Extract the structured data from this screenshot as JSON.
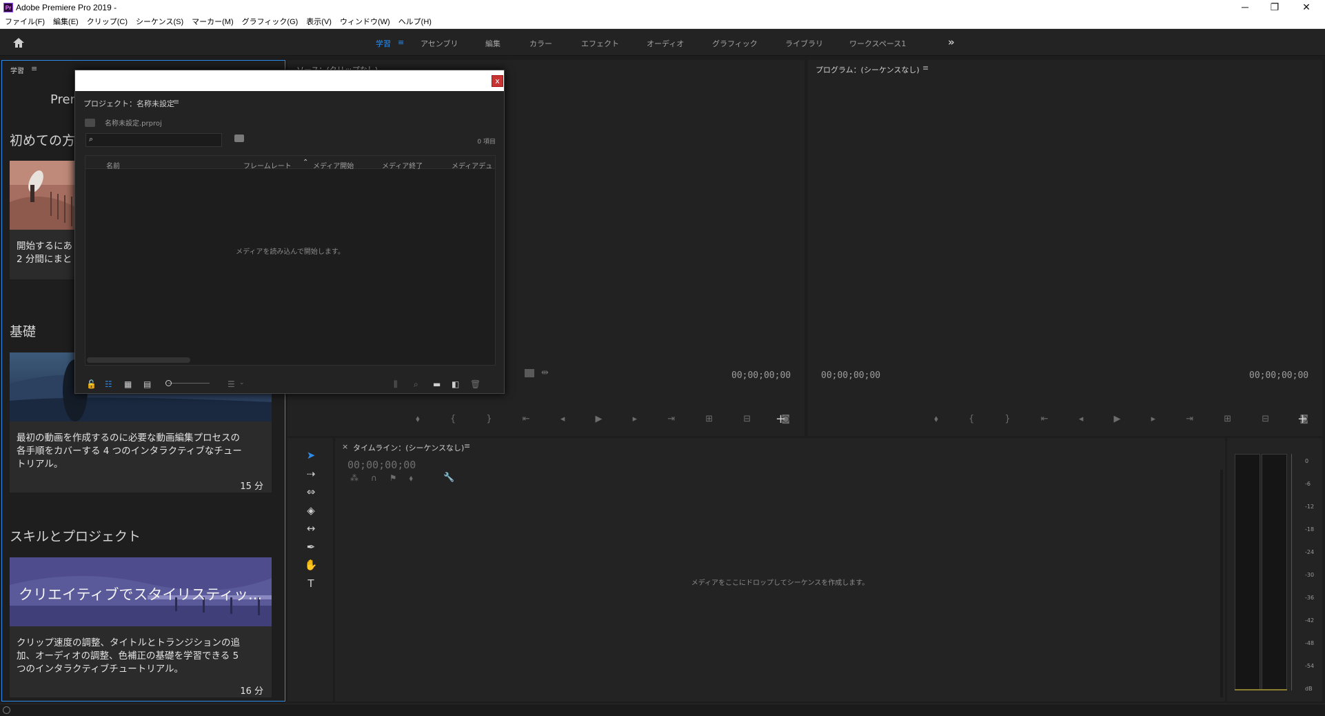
{
  "window": {
    "app_logo": "Pr",
    "title": "Adobe Premiere Pro 2019 -",
    "minimize": "─",
    "restore": "❐",
    "close": "✕"
  },
  "menu": [
    "ファイル(F)",
    "編集(E)",
    "クリップ(C)",
    "シーケンス(S)",
    "マーカー(M)",
    "グラフィック(G)",
    "表示(V)",
    "ウィンドウ(W)",
    "ヘルプ(H)"
  ],
  "workspaces": {
    "items": [
      "学習",
      "アセンブリ",
      "編集",
      "カラー",
      "エフェクト",
      "オーディオ",
      "グラフィック",
      "ライブラリ",
      "ワークスペース1"
    ],
    "active": "学習",
    "accent_color": "#2d8ceb",
    "more_icon": "»",
    "menu_icon": "≡"
  },
  "learn": {
    "tab": "学習",
    "menu_icon": "≡",
    "brand": "Pren",
    "sections": [
      {
        "title": "初めての方"
      },
      {
        "title": "基礎"
      },
      {
        "title": "スキルとプロジェクト"
      }
    ],
    "cards": [
      {
        "desc_lines": [
          "開始するにあ",
          "2 分間にまと"
        ],
        "duration": ""
      },
      {
        "desc_lines": [
          "最初の動画を作成するのに必要な動画編集プロセスの",
          "各手順をカバーする 4 つのインタラクティブなチュー",
          "トリアル。"
        ],
        "duration": "15 分"
      },
      {
        "thumb_title": "クリエイティブでスタイリスティッ...",
        "desc_lines": [
          "クリップ速度の調整、タイトルとトランジションの追",
          "加、オーディオの調整、色補正の基礎を学習できる 5",
          "つのインタラクティブチュートリアル。"
        ],
        "duration": "16 分"
      }
    ]
  },
  "source": {
    "title": "ソース：(クリップなし)",
    "timecode_right": "00;00;00;00"
  },
  "program": {
    "title": "プログラム：(シーケンスなし)",
    "menu_icon": "≡",
    "timecode_left": "00;00;00;00",
    "timecode_right": "00;00;00;00"
  },
  "timeline": {
    "close_icon": "×",
    "title": "タイムライン：(シーケンスなし)",
    "menu_icon": "≡",
    "timecode": "00;00;00;00",
    "empty_message": "メディアをここにドロップしてシーケンスを作成します。"
  },
  "meter": {
    "db_labels": [
      "0",
      "-6",
      "-12",
      "-18",
      "-24",
      "-30",
      "-36",
      "-42",
      "-48",
      "-54",
      "dB"
    ]
  },
  "project_dialog": {
    "close": "x",
    "title": "プロジェクト：名称未設定",
    "menu_icon": "≡",
    "file_name": "名称未設定.prproj",
    "item_count": "0 項目",
    "columns": [
      "名前",
      "フレームレート",
      "メディア開始",
      "メディア終了",
      "メディアデュ"
    ],
    "empty_message": "メディアを読み込んで開始します。"
  }
}
